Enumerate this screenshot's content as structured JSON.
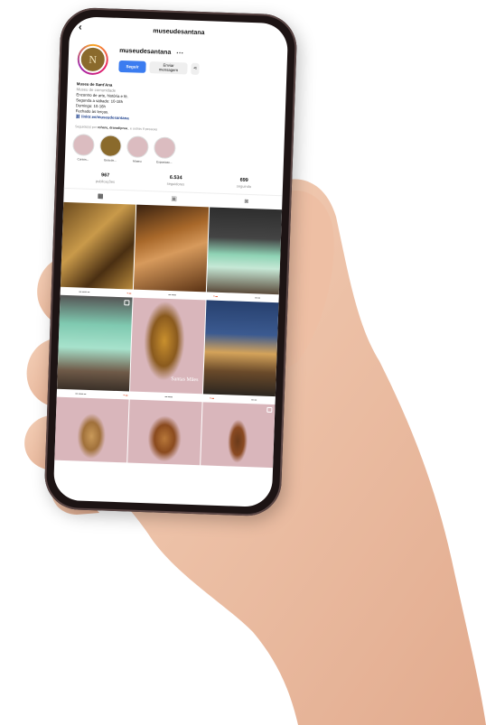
{
  "header": {
    "title": "museudesantana"
  },
  "profile": {
    "username": "museudesantana",
    "avatar_initial": "N",
    "follow_label": "Seguir",
    "message_label": "Enviar mensagem"
  },
  "bio": {
    "name": "Museu de Sant'Ana",
    "category": "Museu de comunidade",
    "lines": [
      "Encontro de arte, história e fé.",
      "Segunda a sábado: 10-18h",
      "Domingo: 10-16h",
      "Fechado às terças."
    ],
    "link": "linktr.ee/museudesantana"
  },
  "followed_by": {
    "prefix": "Seguido(a) por",
    "names": "rohare, draradiprea_",
    "suffix": "e outras 9 pessoas"
  },
  "highlights": [
    {
      "label": "Cursos...",
      "color": "#dbbcc0"
    },
    {
      "label": "Guia de...",
      "color": "#8a6a2c"
    },
    {
      "label": "Museu",
      "color": "#dbbcc0"
    },
    {
      "label": "Exposicao...",
      "color": "#dbbcc0"
    }
  ],
  "stats": [
    {
      "num": "967",
      "label": "publicações"
    },
    {
      "num": "6.534",
      "label": "seguidores"
    },
    {
      "num": "699",
      "label": "seguindo"
    }
  ],
  "tabs": [
    "grid-icon",
    "reels-icon",
    "tagged-icon"
  ],
  "post_overlay": "Santas Mães",
  "colors": {
    "accent_blue": "#3b7cf0",
    "pink_bg": "#d9b6bb",
    "gold": "#8a6a2c"
  }
}
